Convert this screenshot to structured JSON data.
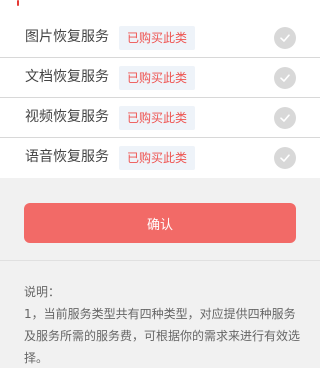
{
  "services": [
    {
      "label": "图片恢复服务",
      "status": "已购买此类"
    },
    {
      "label": "文档恢复服务",
      "status": "已购买此类"
    },
    {
      "label": "视频恢复服务",
      "status": "已购买此类"
    },
    {
      "label": "语音恢复服务",
      "status": "已购买此类"
    }
  ],
  "confirm_label": "确认",
  "notes": {
    "title": "说明：",
    "item1": "1，当前服务类型共有四种类型，对应提供四种服务及服务所需的服务费，可根据你的需求来进行有效选择。"
  }
}
